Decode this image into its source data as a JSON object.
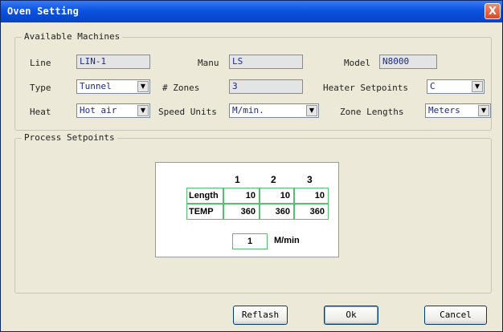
{
  "window": {
    "title": "Oven Setting",
    "close_label": "X"
  },
  "available_machines": {
    "legend": "Available Machines",
    "line_label": "Line",
    "line_value": "LIN-1",
    "manu_label": "Manu",
    "manu_value": "LS",
    "model_label": "Model",
    "model_value": "N8000",
    "type_label": "Type",
    "type_value": "Tunnel",
    "zones_label": "# Zones",
    "zones_value": "3",
    "heater_label": "Heater Setpoints",
    "heater_value": "C",
    "heat_label": "Heat",
    "heat_value": "Hot air",
    "speed_units_label": "Speed Units",
    "speed_units_value": "M/min.",
    "zone_lengths_label": "Zone Lengths",
    "zone_lengths_value": "Meters"
  },
  "process_setpoints": {
    "legend": "Process Setpoints",
    "columns": [
      "1",
      "2",
      "3"
    ],
    "rows": [
      {
        "label": "Length",
        "values": [
          "10",
          "10",
          "10"
        ]
      },
      {
        "label": "TEMP",
        "values": [
          "360",
          "360",
          "360"
        ]
      }
    ],
    "speed_value": "1",
    "speed_unit": "M/min"
  },
  "buttons": {
    "refresh": "Reflash",
    "ok": "Ok",
    "cancel": "Cancel"
  },
  "icons": {
    "dropdown": "chevron-down-icon",
    "close": "close-icon"
  }
}
